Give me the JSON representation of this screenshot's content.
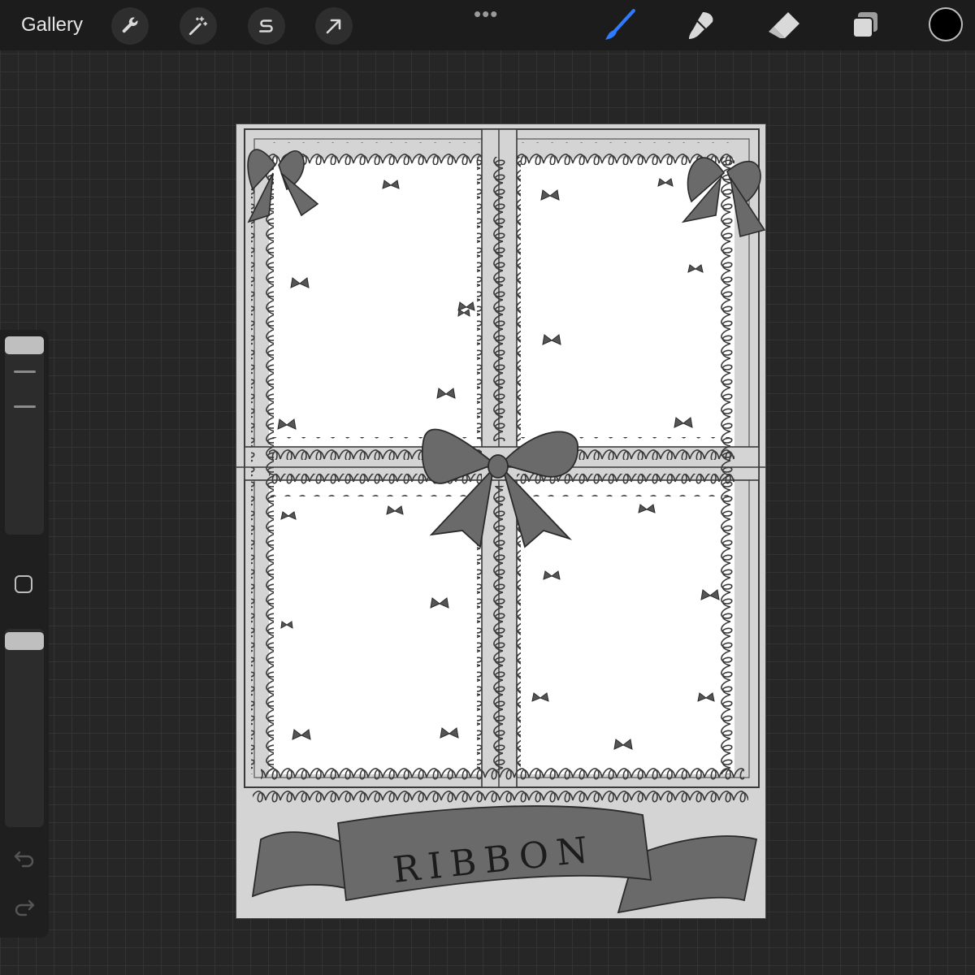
{
  "toolbar": {
    "gallery_label": "Gallery",
    "left_tools": [
      {
        "name": "actions",
        "icon": "wrench-icon"
      },
      {
        "name": "adjustments",
        "icon": "magic-wand-icon"
      },
      {
        "name": "selection",
        "icon": "selection-s-icon"
      },
      {
        "name": "transform",
        "icon": "arrow-cursor-icon"
      }
    ],
    "more_icon": "more-dots-icon",
    "right_tools": [
      {
        "name": "brush",
        "icon": "brush-icon",
        "active": true
      },
      {
        "name": "smudge",
        "icon": "smudge-icon"
      },
      {
        "name": "eraser",
        "icon": "eraser-icon"
      },
      {
        "name": "layers",
        "icon": "layers-icon"
      }
    ],
    "active_color": "#000000",
    "accent_color": "#2f7bff"
  },
  "sidebar": {
    "brush_size_icon": "size-slider",
    "opacity_icon": "opacity-slider",
    "modify_icon": "square-modify-icon",
    "undo_icon": "undo-arrow-icon",
    "redo_icon": "redo-arrow-icon"
  },
  "artwork": {
    "banner_text": "RIBBON",
    "description_colors": {
      "paper": "#ffffff",
      "frame": "#d4d4d4",
      "ink": "#333333",
      "fill": "#6a6a6a"
    }
  }
}
